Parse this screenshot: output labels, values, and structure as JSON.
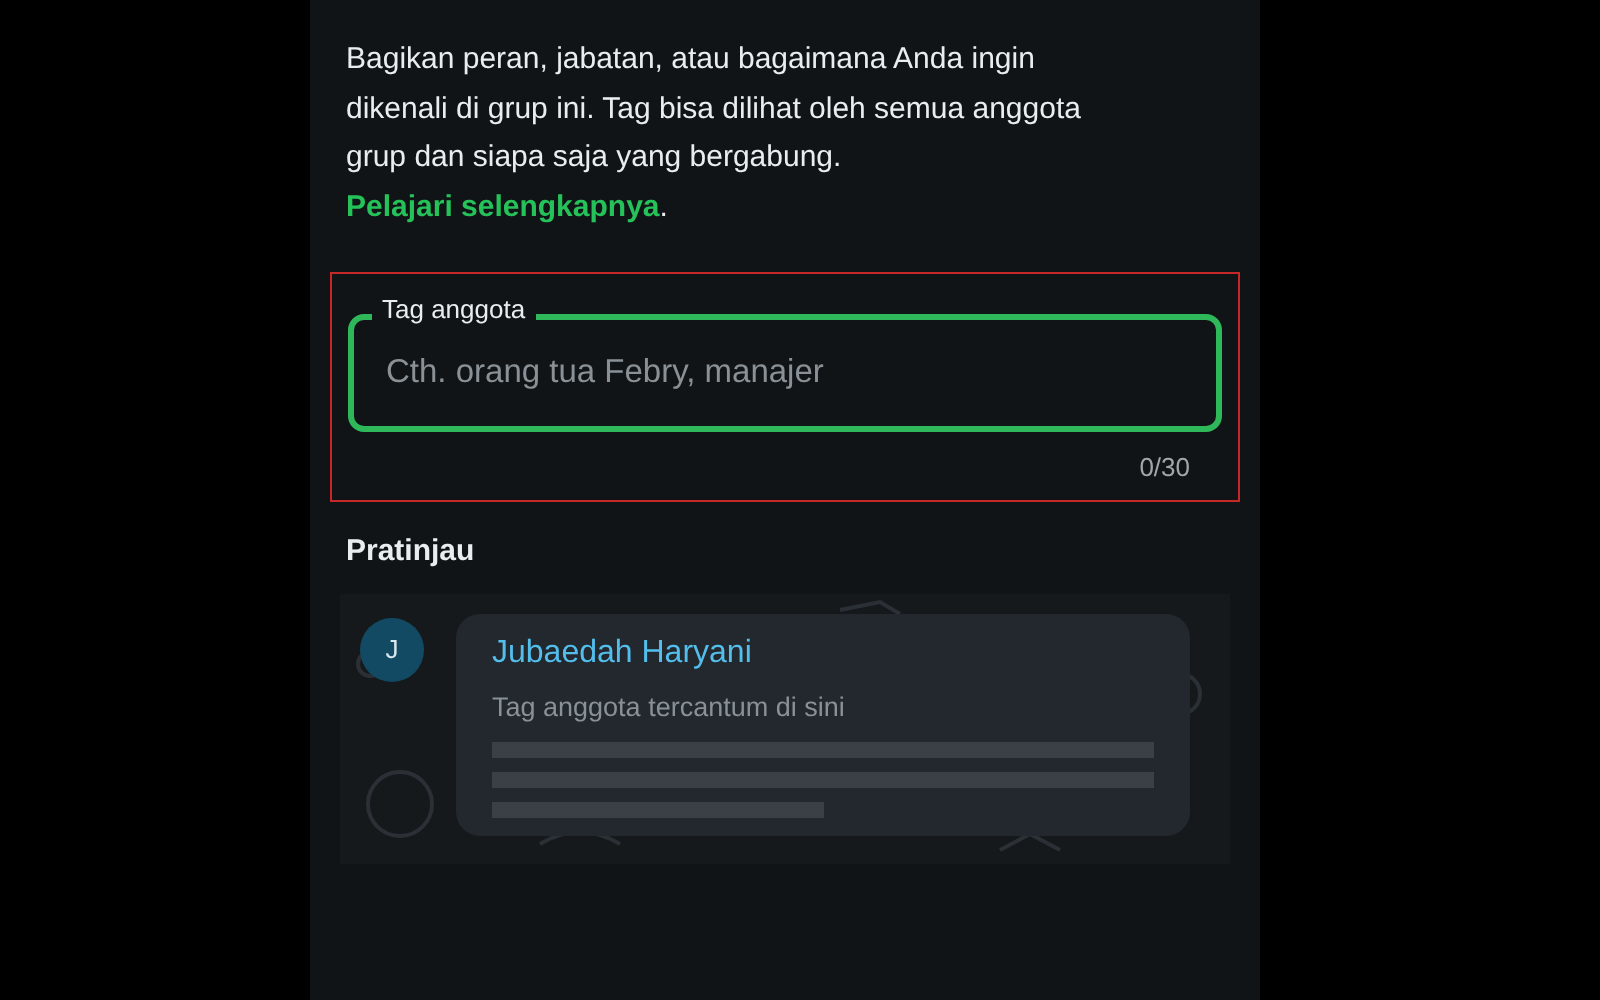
{
  "description": {
    "text": "Bagikan peran, jabatan, atau bagaimana Anda ingin dikenali di grup ini. Tag bisa dilihat oleh semua anggota grup dan siapa saja yang bergabung. ",
    "link": "Pelajari selengkapnya",
    "suffix": "."
  },
  "tag_field": {
    "label": "Tag anggota",
    "placeholder": "Cth. orang tua Febry, manajer",
    "counter": "0/30",
    "highlighted": true
  },
  "preview": {
    "heading": "Pratinjau",
    "avatar_initial": "J",
    "sender": "Jubaedah Haryani",
    "tag": "Tag anggota tercantum di sini"
  }
}
